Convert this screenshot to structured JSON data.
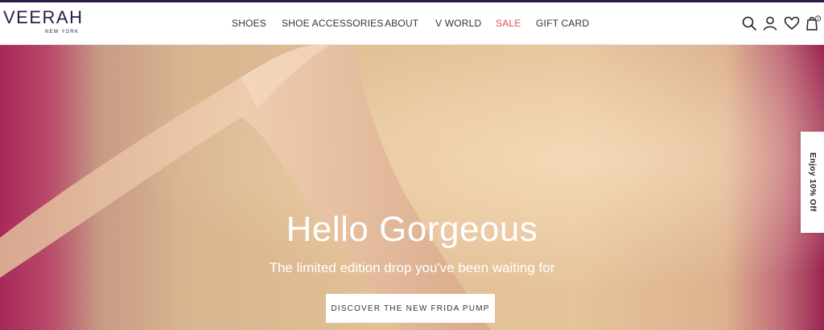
{
  "brand": {
    "name": "VEERAH",
    "tagline": "NEW YORK"
  },
  "nav": {
    "items": [
      {
        "label": "SHOES"
      },
      {
        "label": "SHOE ACCESSORIES"
      },
      {
        "label": "ABOUT"
      },
      {
        "label": "V WORLD"
      },
      {
        "label": "SALE"
      },
      {
        "label": "GIFT CARD"
      }
    ]
  },
  "header_icons": [
    "search-icon",
    "account-icon",
    "heart-icon",
    "cart-icon"
  ],
  "cart": {
    "count": "0"
  },
  "hero": {
    "title": "Hello Gorgeous",
    "subtitle": "The limited edition drop you've been waiting for",
    "cta_label": "DISCOVER THE NEW FRIDA PUMP"
  },
  "promo": {
    "label": "Enjoy 10% Off"
  },
  "colors": {
    "brand": "#2b1b48",
    "sale": "#e0505b",
    "topline": "#2f1a4a"
  }
}
